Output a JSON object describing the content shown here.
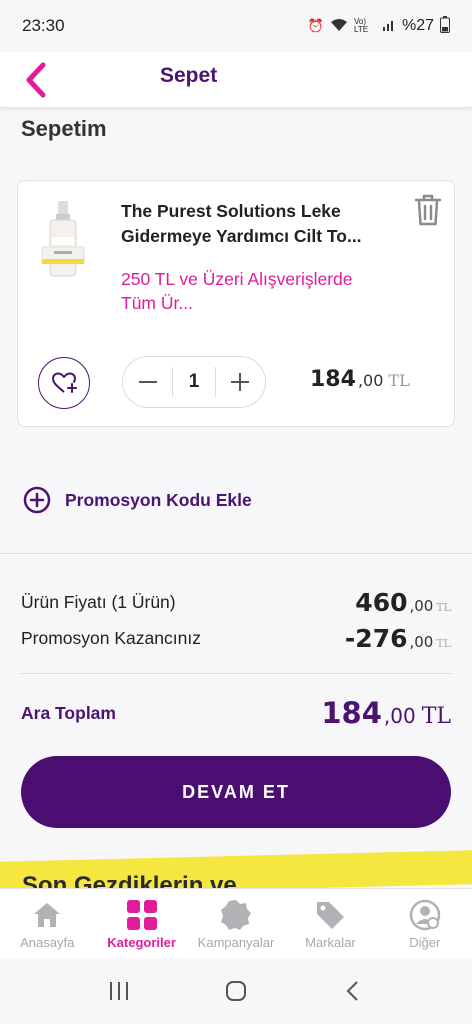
{
  "status": {
    "time": "23:30",
    "battery": "%27",
    "net": "Vo) LTE"
  },
  "header": {
    "title": "Sepet"
  },
  "cart": {
    "title": "Sepetim",
    "item": {
      "name": "The Purest Solutions Leke Gidermeye Yardımcı Cilt To...",
      "promo": "250 TL ve Üzeri Alışverişlerde Tüm Ür...",
      "quantity": "1",
      "price_main": "184",
      "price_dec": ",00",
      "currency": "TL"
    }
  },
  "promo_code": {
    "label": "Promosyon Kodu Ekle"
  },
  "summary": {
    "product_price_label": "Ürün Fiyatı (1 Ürün)",
    "product_price_main": "460",
    "product_price_dec": ",00",
    "discount_label": "Promosyon Kazancınız",
    "discount_main": "-276",
    "discount_dec": ",00",
    "subtotal_label": "Ara Toplam",
    "subtotal_main": "184",
    "subtotal_dec": ",00",
    "currency": "TL"
  },
  "cta": {
    "label": "DEVAM ET"
  },
  "recent": {
    "title": "Son Gezdiklerin ve"
  },
  "bottom_nav": [
    {
      "label": "Anasayfa",
      "icon": "home-icon"
    },
    {
      "label": "Kategoriler",
      "icon": "grid-icon",
      "active": true
    },
    {
      "label": "Kampanyalar",
      "icon": "badge-icon"
    },
    {
      "label": "Markalar",
      "icon": "tag-icon"
    },
    {
      "label": "Diğer",
      "icon": "user-settings-icon"
    }
  ],
  "colors": {
    "brand": "#4b0f72",
    "accent": "#e01c9a",
    "highlight": "#f6e640"
  }
}
